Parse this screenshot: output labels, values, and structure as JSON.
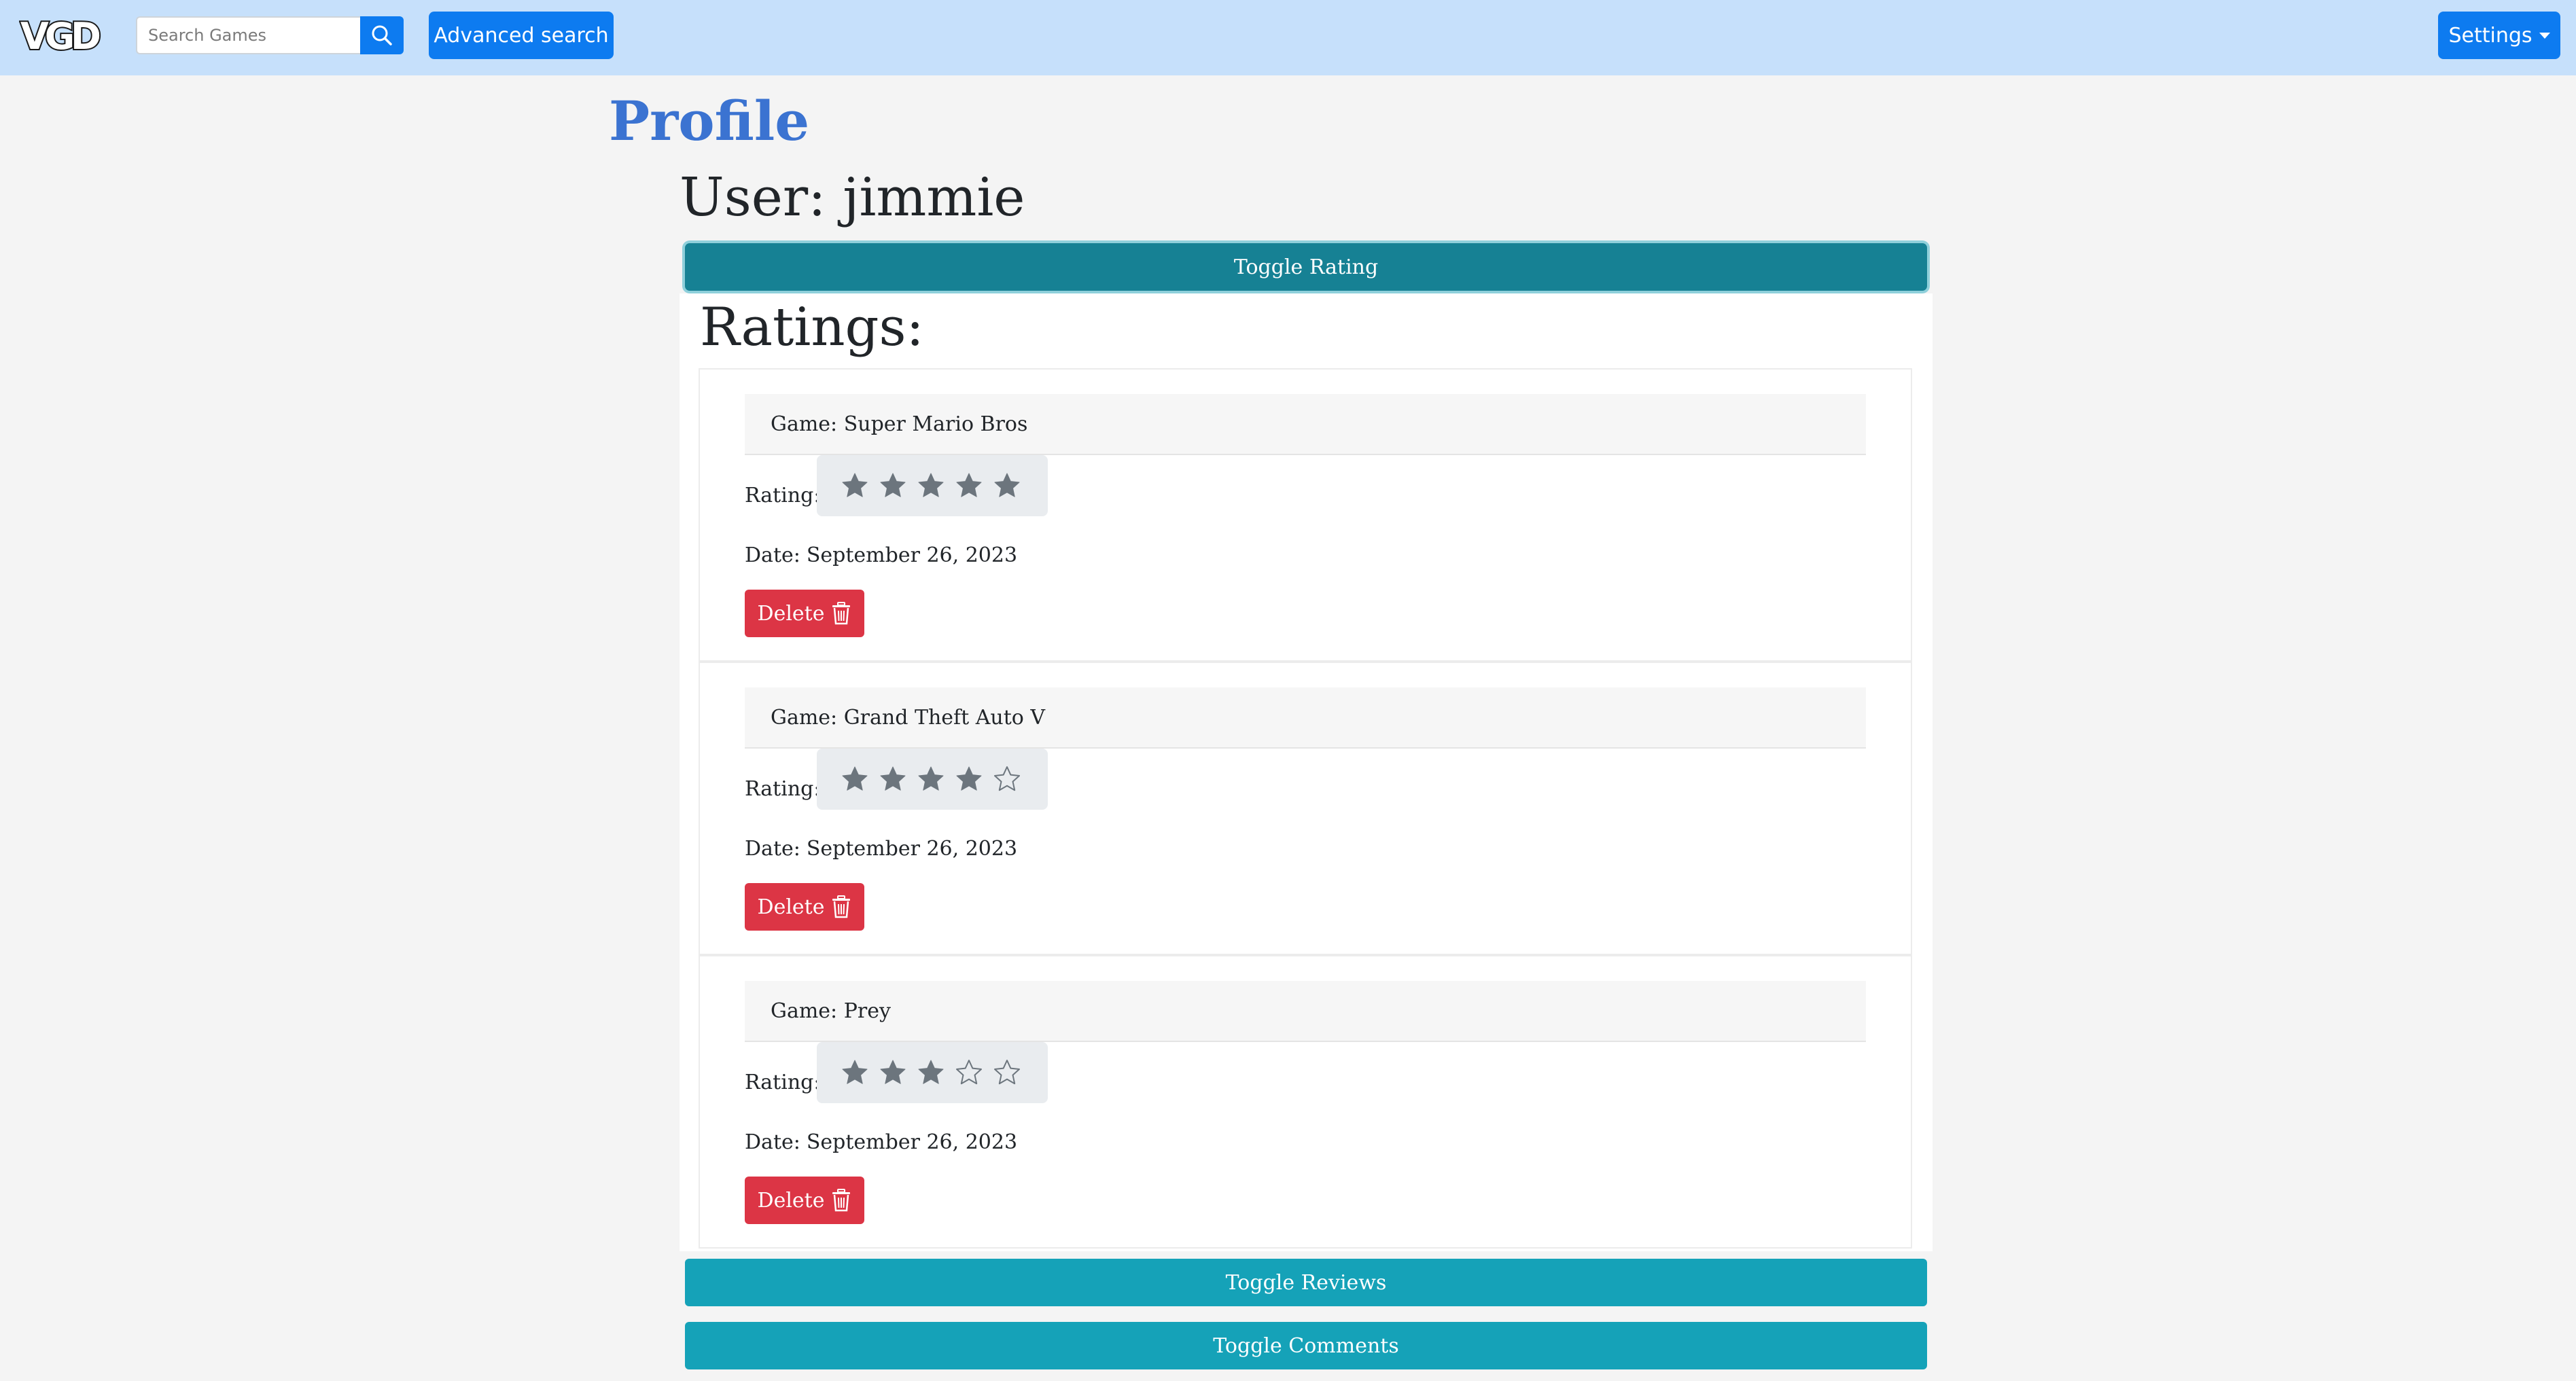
{
  "navbar": {
    "logo_text": "VGD",
    "search_placeholder": "Search Games",
    "search_icon": "search-icon",
    "advanced_search_label": "Advanced search",
    "settings_label": "Settings",
    "colors": {
      "background": "#c6e0fb",
      "button": "#0d7bf0"
    }
  },
  "page": {
    "title": "Profile",
    "user_heading": "User: jimmie"
  },
  "toggles": {
    "rating": "Toggle Rating",
    "reviews": "Toggle Reviews",
    "comments": "Toggle Comments"
  },
  "ratings": {
    "heading": "Ratings:",
    "rating_label": "Rating:",
    "date_label": "Date:",
    "delete_label": "Delete",
    "max_stars": 5,
    "items": [
      {
        "game": "Game: Super Mario Bros",
        "stars": 5,
        "date": "September 26, 2023"
      },
      {
        "game": "Game: Grand Theft Auto V",
        "stars": 4,
        "date": "September 26, 2023"
      },
      {
        "game": "Game: Prey",
        "stars": 3,
        "date": "September 26, 2023"
      }
    ]
  },
  "colors": {
    "profile_title": "#3b73d1",
    "toggle_active": "#168194",
    "toggle": "#15a2b8",
    "delete": "#dc3545",
    "star": "#6c757d"
  }
}
